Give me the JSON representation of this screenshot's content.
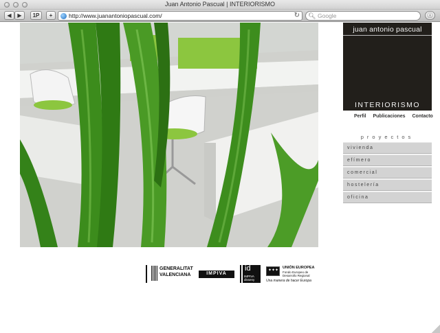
{
  "window": {
    "title": "Juan Antonio Pascual | INTERIORISMO"
  },
  "toolbar": {
    "back_label": "◀",
    "forward_label": "▶",
    "onepassword_label": "1P",
    "add_label": "+",
    "url": "http://www.juanantoniopascual.com/",
    "search_placeholder": "Google",
    "reload_glyph": "↻",
    "status_glyph": "ⓘ"
  },
  "logo": {
    "name": "juan antonio pascual",
    "tag": "INTERIORISMO"
  },
  "top_links": [
    "Perfil",
    "Publicaciones",
    "Contacto"
  ],
  "projects": {
    "title": "proyectos",
    "items": [
      "vivienda",
      "efímero",
      "comercial",
      "hostelería",
      "oficina"
    ]
  },
  "sponsors": {
    "generalitat_line1": "GENERALITAT",
    "generalitat_line2": "VALENCIANA",
    "impiva": "IMPIVA",
    "id_mark": "id",
    "id_sub1": "IMPIVA",
    "id_sub2": "disseny",
    "eu_title": "UNIÓN EUROPEA",
    "eu_line1": "Fondo Europeo de",
    "eu_line2": "Desarrollo Regional",
    "eu_motto": "Una manera de hacer Europa"
  },
  "colors": {
    "logo_bg": "#221f1b",
    "menu_bg": "#d3d3d3",
    "stem_green": "#3f8f1f",
    "chair_green": "#8cc63f"
  }
}
